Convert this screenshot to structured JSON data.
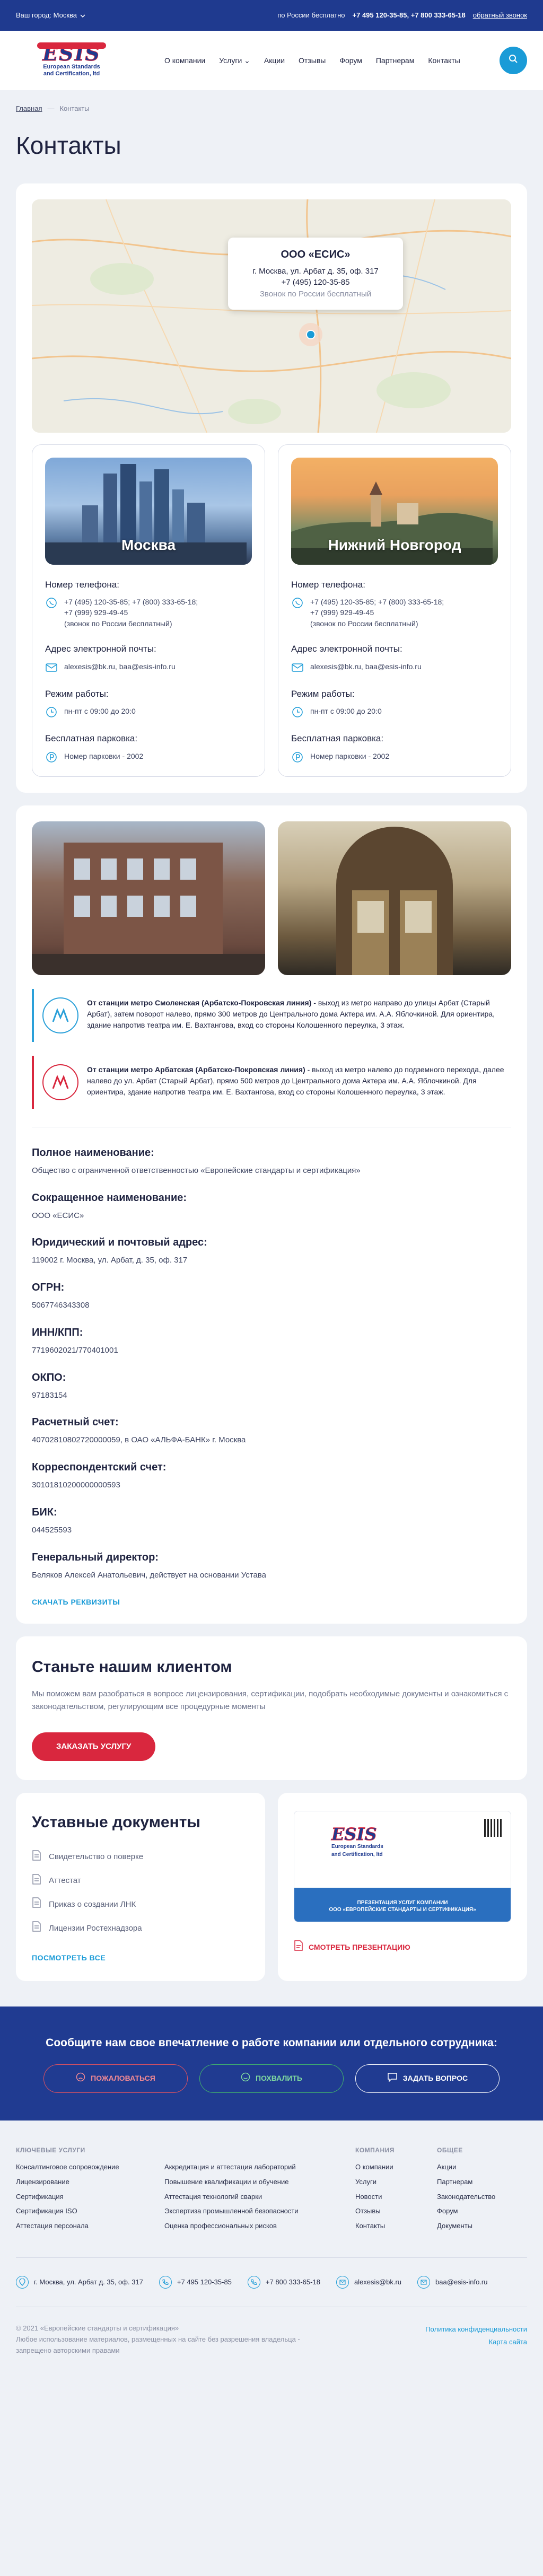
{
  "topbar": {
    "city_label": "Ваш город: Москва",
    "free_label": "по России бесплатно",
    "phones": "+7 495 120-35-85, +7 800 333-65-18",
    "callback": "обратный звонок"
  },
  "logo": {
    "name": "ESIS",
    "line1": "European Standards",
    "line2": "and Certification, ltd"
  },
  "nav": [
    "О компании",
    "Услуги",
    "Акции",
    "Отзывы",
    "Форум",
    "Партнерам",
    "Контакты"
  ],
  "breadcrumbs": {
    "home": "Главная",
    "sep": "—",
    "current": "Контакты"
  },
  "page_title": "Контакты",
  "map": {
    "company": "ООО «ЕСИС»",
    "address": "г. Москва, ул. Арбат д. 35, оф. 317",
    "phone": "+7 (495) 120-35-85",
    "free": "Звонок по России бесплатный"
  },
  "offices": [
    {
      "city": "Москва",
      "phone_label": "Номер телефона:",
      "phones": [
        "+7 (495) 120-35-85; +7 (800) 333-65-18;",
        "+7 (999) 929-49-45",
        "(звонок по России бесплатный)"
      ],
      "email_label": "Адрес электронной почты:",
      "email": "alexesis@bk.ru, baa@esis-info.ru",
      "hours_label": "Режим работы:",
      "hours": "пн-пт с 09:00 до 20:0",
      "parking_label": "Бесплатная парковка:",
      "parking": "Номер парковки - 2002"
    },
    {
      "city": "Нижний Новгород",
      "phone_label": "Номер телефона:",
      "phones": [
        "+7 (495) 120-35-85; +7 (800) 333-65-18;",
        "+7 (999) 929-49-45",
        "(звонок по России бесплатный)"
      ],
      "email_label": "Адрес электронной почты:",
      "email": "alexesis@bk.ru, baa@esis-info.ru",
      "hours_label": "Режим работы:",
      "hours": "пн-пт с 09:00 до 20:0",
      "parking_label": "Бесплатная парковка:",
      "parking": "Номер парковки - 2002"
    }
  ],
  "metro": [
    {
      "bold": "От станции метро Смоленская (Арбатско-Покровская линия)",
      "text": " - выход из метро направо до улицы Арбат (Старый Арбат), затем поворот налево, прямо 300 метров до Центрального дома Актера им. А.А. Яблочкиной. Для ориентира, здание напротив театра им. Е. Вахтангова, вход со стороны Колошенного переулка, 3 этаж."
    },
    {
      "bold": "От станции метро Арбатская (Арбатско-Покровская линия)",
      "text": " - выход из метро налево до подземного перехода, далее налево до ул. Арбат (Старый Арбат), прямо 500 метров до Центрального дома Актера им. А.А. Яблочкиной. Для ориентира, здание напротив театра им. Е. Вахтангова, вход со стороны Колошенного переулка, 3 этаж."
    }
  ],
  "requisites": [
    {
      "k": "Полное наименование:",
      "v": "Общество с ограниченной ответственностью «Европейские стандарты и сертификация»"
    },
    {
      "k": "Сокращенное наименование:",
      "v": "ООО «ЕСИС»"
    },
    {
      "k": "Юридический и почтовый адрес:",
      "v": "119002 г. Москва, ул. Арбат, д. 35, оф. 317"
    },
    {
      "k": "ОГРН:",
      "v": "5067746343308"
    },
    {
      "k": "ИНН/КПП:",
      "v": "7719602021/770401001"
    },
    {
      "k": "ОКПО:",
      "v": "97183154"
    },
    {
      "k": "Расчетный счет:",
      "v": "40702810802720000059, в ОАО «АЛЬФА-БАНК» г. Москва"
    },
    {
      "k": "Корреспондентский счет:",
      "v": "30101810200000000593"
    },
    {
      "k": "БИК:",
      "v": "044525593"
    },
    {
      "k": "Генеральный директор:",
      "v": "Беляков Алексей Анатольевич, действует на основании Устава"
    }
  ],
  "download_requisites": "СКАЧАТЬ РЕКВИЗИТЫ",
  "client": {
    "title": "Станьте нашим клиентом",
    "text": "Мы поможем вам разобраться в вопросе лицензирования, сертификации, подобрать необходимые документы и ознакомиться с законодательством, регулирующим все процедурные моменты",
    "button": "ЗАКАЗАТЬ УСЛУГУ"
  },
  "docs": {
    "title": "Уставные документы",
    "items": [
      "Свидетельство о поверке",
      "Аттестат",
      "Приказ о создании ЛНК",
      "Лицензии Ростехнадзора"
    ],
    "see_all": "ПОСМОТРЕТЬ ВСЕ"
  },
  "presentation": {
    "logo": "ESIS",
    "sub1": "European Standards",
    "sub2": "and Certification, ltd",
    "line1": "ПРЕЗЕНТАЦИЯ УСЛУГ КОМПАНИИ",
    "line2": "ООО «ЕВРОПЕЙСКИЕ СТАНДАРТЫ И СЕРТИФИКАЦИЯ»",
    "button": "СМОТРЕТЬ ПРЕЗЕНТАЦИЮ"
  },
  "feedback": {
    "title": "Сообщите нам свое впечатление о работе компании или отдельного сотрудника:",
    "complain": "ПОЖАЛОВАТЬСЯ",
    "praise": "ПОХВАЛИТЬ",
    "ask": "ЗАДАТЬ ВОПРОС"
  },
  "footer": {
    "col1_title": "КЛЮЧЕВЫЕ УСЛУГИ",
    "col1": [
      "Консалтинговое сопровождение",
      "Лицензирование",
      "Сертификация",
      "Сертификация ISO",
      "Аттестация персонала"
    ],
    "col2": [
      "Аккредитация и аттестация лабораторий",
      "Повышение квалификации и обучение",
      "Аттестация технологий сварки",
      "Экспертиза промышленной безопасности",
      "Оценка профессиональных рисков"
    ],
    "col3_title": "КОМПАНИЯ",
    "col3": [
      "О компании",
      "Услуги",
      "Новости",
      "Отзывы",
      "Контакты"
    ],
    "col4_title": "ОБЩЕЕ",
    "col4": [
      "Акции",
      "Партнерам",
      "Законодательство",
      "Форум",
      "Документы"
    ],
    "contacts": [
      "г. Москва, ул. Арбат д. 35, оф. 317",
      "+7 495 120-35-85",
      "+7 800 333-65-18",
      "alexesis@bk.ru",
      "baa@esis-info.ru"
    ],
    "copyright": "© 2021 «Европейские стандарты и сертификация»",
    "notice1": "Любое использование материалов, размещенных на сайте без разрешения владельца -",
    "notice2": "запрещено авторскими правами",
    "privacy": "Политика конфиденциальности",
    "sitemap": "Карта сайта"
  }
}
